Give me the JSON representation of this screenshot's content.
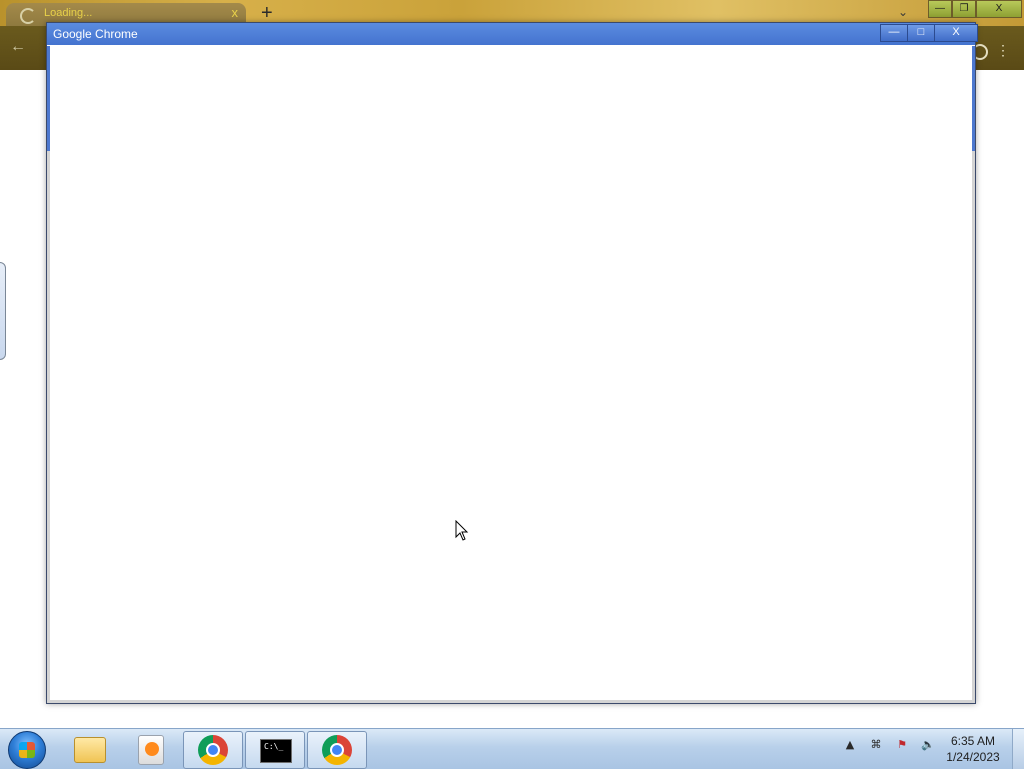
{
  "background_browser": {
    "tab": {
      "title": "Loading...",
      "close_label": "x"
    },
    "new_tab_label": "+",
    "tab_search_label": "⌄",
    "window_controls": {
      "minimize": "—",
      "restore": "❐",
      "close": "X"
    },
    "back_label": "←",
    "menu_label": "⋮"
  },
  "popup_window": {
    "title": "Google Chrome",
    "controls": {
      "minimize": "—",
      "maximize": "□",
      "close": "X"
    }
  },
  "taskbar": {
    "clock": {
      "time": "6:35 AM",
      "date": "1/24/2023"
    },
    "tray": {
      "overflow_label": "▲",
      "network_label": "⌘",
      "flag_label": "⚑",
      "volume_label": "🔈"
    }
  },
  "colors": {
    "popup_titlebar": "#4d78cf",
    "theme_toolbar": "#5a4a16",
    "taskbar": "#b8d0ea"
  },
  "icons": [
    "chrome-icon",
    "folder-icon",
    "media-player-icon",
    "command-prompt-icon",
    "start-icon"
  ]
}
